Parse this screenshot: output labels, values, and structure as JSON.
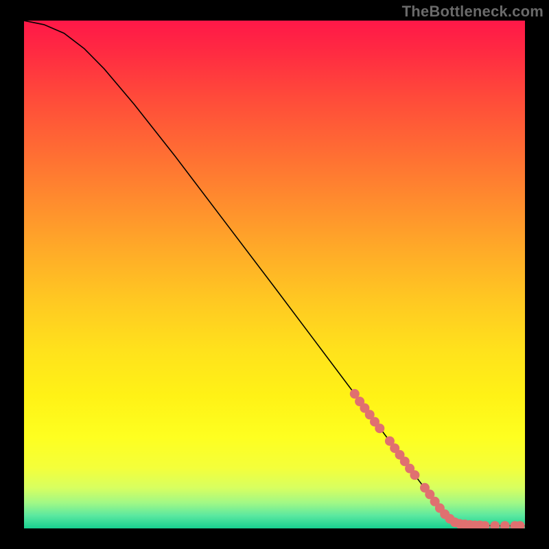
{
  "watermark": "TheBottleneck.com",
  "chart_data": {
    "type": "line",
    "title": "",
    "xlabel": "",
    "ylabel": "",
    "xlim": [
      0,
      100
    ],
    "ylim": [
      0,
      100
    ],
    "curve": {
      "name": "bottleneck-curve",
      "color": "#000000",
      "points": [
        {
          "x": 0,
          "y": 100
        },
        {
          "x": 4,
          "y": 99.2
        },
        {
          "x": 8,
          "y": 97.5
        },
        {
          "x": 12,
          "y": 94.5
        },
        {
          "x": 16,
          "y": 90.5
        },
        {
          "x": 22,
          "y": 83.5
        },
        {
          "x": 30,
          "y": 73.5
        },
        {
          "x": 40,
          "y": 60.5
        },
        {
          "x": 50,
          "y": 47.5
        },
        {
          "x": 58,
          "y": 37.0
        },
        {
          "x": 66,
          "y": 26.5
        },
        {
          "x": 72,
          "y": 18.5
        },
        {
          "x": 78,
          "y": 10.5
        },
        {
          "x": 83,
          "y": 4.0
        },
        {
          "x": 86,
          "y": 1.2
        },
        {
          "x": 90,
          "y": 0.6
        },
        {
          "x": 95,
          "y": 0.5
        },
        {
          "x": 100,
          "y": 0.5
        }
      ]
    },
    "points_on_curve": {
      "name": "highlight-markers",
      "color": "#E07070",
      "radius": 7,
      "points": [
        {
          "x": 66,
          "y": 26.5
        },
        {
          "x": 67,
          "y": 25.0
        },
        {
          "x": 68,
          "y": 23.7
        },
        {
          "x": 69,
          "y": 22.4
        },
        {
          "x": 70,
          "y": 21.0
        },
        {
          "x": 71,
          "y": 19.7
        },
        {
          "x": 73,
          "y": 17.2
        },
        {
          "x": 74,
          "y": 15.8
        },
        {
          "x": 75,
          "y": 14.5
        },
        {
          "x": 76,
          "y": 13.2
        },
        {
          "x": 77,
          "y": 11.8
        },
        {
          "x": 78,
          "y": 10.5
        },
        {
          "x": 80,
          "y": 8.0
        },
        {
          "x": 81,
          "y": 6.7
        },
        {
          "x": 82,
          "y": 5.3
        },
        {
          "x": 83,
          "y": 4.0
        },
        {
          "x": 84,
          "y": 2.8
        },
        {
          "x": 85,
          "y": 1.9
        },
        {
          "x": 86,
          "y": 1.2
        },
        {
          "x": 87,
          "y": 0.9
        },
        {
          "x": 88,
          "y": 0.8
        },
        {
          "x": 89,
          "y": 0.7
        },
        {
          "x": 90,
          "y": 0.6
        },
        {
          "x": 91,
          "y": 0.6
        },
        {
          "x": 92,
          "y": 0.5
        },
        {
          "x": 94,
          "y": 0.5
        },
        {
          "x": 96,
          "y": 0.5
        },
        {
          "x": 98,
          "y": 0.5
        },
        {
          "x": 99,
          "y": 0.5
        }
      ]
    },
    "background_gradient": {
      "type": "vertical",
      "stops": [
        {
          "offset": 0.0,
          "color": "#ff1848"
        },
        {
          "offset": 0.06,
          "color": "#ff2a42"
        },
        {
          "offset": 0.15,
          "color": "#ff4a3a"
        },
        {
          "offset": 0.25,
          "color": "#ff6a34"
        },
        {
          "offset": 0.35,
          "color": "#ff8a2e"
        },
        {
          "offset": 0.45,
          "color": "#ffaa28"
        },
        {
          "offset": 0.55,
          "color": "#ffc822"
        },
        {
          "offset": 0.65,
          "color": "#ffe21c"
        },
        {
          "offset": 0.74,
          "color": "#fff216"
        },
        {
          "offset": 0.82,
          "color": "#feff20"
        },
        {
          "offset": 0.88,
          "color": "#f4ff3a"
        },
        {
          "offset": 0.92,
          "color": "#d8ff60"
        },
        {
          "offset": 0.95,
          "color": "#a0f886"
        },
        {
          "offset": 0.975,
          "color": "#5ae8a0"
        },
        {
          "offset": 1.0,
          "color": "#18d090"
        }
      ]
    }
  }
}
